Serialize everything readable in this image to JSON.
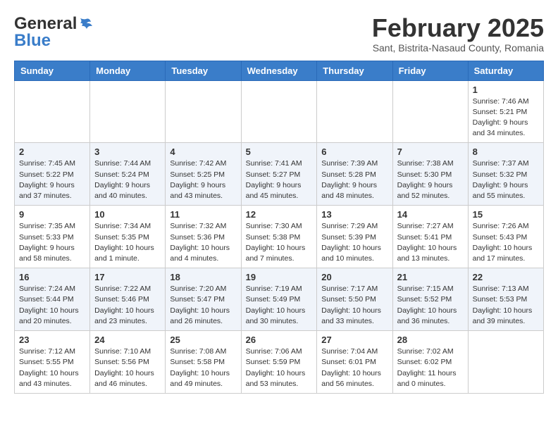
{
  "header": {
    "logo_general": "General",
    "logo_blue": "Blue",
    "month_year": "February 2025",
    "location": "Sant, Bistrita-Nasaud County, Romania"
  },
  "days_of_week": [
    "Sunday",
    "Monday",
    "Tuesday",
    "Wednesday",
    "Thursday",
    "Friday",
    "Saturday"
  ],
  "weeks": [
    [
      {
        "day": "",
        "info": ""
      },
      {
        "day": "",
        "info": ""
      },
      {
        "day": "",
        "info": ""
      },
      {
        "day": "",
        "info": ""
      },
      {
        "day": "",
        "info": ""
      },
      {
        "day": "",
        "info": ""
      },
      {
        "day": "1",
        "info": "Sunrise: 7:46 AM\nSunset: 5:21 PM\nDaylight: 9 hours and 34 minutes."
      }
    ],
    [
      {
        "day": "2",
        "info": "Sunrise: 7:45 AM\nSunset: 5:22 PM\nDaylight: 9 hours and 37 minutes."
      },
      {
        "day": "3",
        "info": "Sunrise: 7:44 AM\nSunset: 5:24 PM\nDaylight: 9 hours and 40 minutes."
      },
      {
        "day": "4",
        "info": "Sunrise: 7:42 AM\nSunset: 5:25 PM\nDaylight: 9 hours and 43 minutes."
      },
      {
        "day": "5",
        "info": "Sunrise: 7:41 AM\nSunset: 5:27 PM\nDaylight: 9 hours and 45 minutes."
      },
      {
        "day": "6",
        "info": "Sunrise: 7:39 AM\nSunset: 5:28 PM\nDaylight: 9 hours and 48 minutes."
      },
      {
        "day": "7",
        "info": "Sunrise: 7:38 AM\nSunset: 5:30 PM\nDaylight: 9 hours and 52 minutes."
      },
      {
        "day": "8",
        "info": "Sunrise: 7:37 AM\nSunset: 5:32 PM\nDaylight: 9 hours and 55 minutes."
      }
    ],
    [
      {
        "day": "9",
        "info": "Sunrise: 7:35 AM\nSunset: 5:33 PM\nDaylight: 9 hours and 58 minutes."
      },
      {
        "day": "10",
        "info": "Sunrise: 7:34 AM\nSunset: 5:35 PM\nDaylight: 10 hours and 1 minute."
      },
      {
        "day": "11",
        "info": "Sunrise: 7:32 AM\nSunset: 5:36 PM\nDaylight: 10 hours and 4 minutes."
      },
      {
        "day": "12",
        "info": "Sunrise: 7:30 AM\nSunset: 5:38 PM\nDaylight: 10 hours and 7 minutes."
      },
      {
        "day": "13",
        "info": "Sunrise: 7:29 AM\nSunset: 5:39 PM\nDaylight: 10 hours and 10 minutes."
      },
      {
        "day": "14",
        "info": "Sunrise: 7:27 AM\nSunset: 5:41 PM\nDaylight: 10 hours and 13 minutes."
      },
      {
        "day": "15",
        "info": "Sunrise: 7:26 AM\nSunset: 5:43 PM\nDaylight: 10 hours and 17 minutes."
      }
    ],
    [
      {
        "day": "16",
        "info": "Sunrise: 7:24 AM\nSunset: 5:44 PM\nDaylight: 10 hours and 20 minutes."
      },
      {
        "day": "17",
        "info": "Sunrise: 7:22 AM\nSunset: 5:46 PM\nDaylight: 10 hours and 23 minutes."
      },
      {
        "day": "18",
        "info": "Sunrise: 7:20 AM\nSunset: 5:47 PM\nDaylight: 10 hours and 26 minutes."
      },
      {
        "day": "19",
        "info": "Sunrise: 7:19 AM\nSunset: 5:49 PM\nDaylight: 10 hours and 30 minutes."
      },
      {
        "day": "20",
        "info": "Sunrise: 7:17 AM\nSunset: 5:50 PM\nDaylight: 10 hours and 33 minutes."
      },
      {
        "day": "21",
        "info": "Sunrise: 7:15 AM\nSunset: 5:52 PM\nDaylight: 10 hours and 36 minutes."
      },
      {
        "day": "22",
        "info": "Sunrise: 7:13 AM\nSunset: 5:53 PM\nDaylight: 10 hours and 39 minutes."
      }
    ],
    [
      {
        "day": "23",
        "info": "Sunrise: 7:12 AM\nSunset: 5:55 PM\nDaylight: 10 hours and 43 minutes."
      },
      {
        "day": "24",
        "info": "Sunrise: 7:10 AM\nSunset: 5:56 PM\nDaylight: 10 hours and 46 minutes."
      },
      {
        "day": "25",
        "info": "Sunrise: 7:08 AM\nSunset: 5:58 PM\nDaylight: 10 hours and 49 minutes."
      },
      {
        "day": "26",
        "info": "Sunrise: 7:06 AM\nSunset: 5:59 PM\nDaylight: 10 hours and 53 minutes."
      },
      {
        "day": "27",
        "info": "Sunrise: 7:04 AM\nSunset: 6:01 PM\nDaylight: 10 hours and 56 minutes."
      },
      {
        "day": "28",
        "info": "Sunrise: 7:02 AM\nSunset: 6:02 PM\nDaylight: 11 hours and 0 minutes."
      },
      {
        "day": "",
        "info": ""
      }
    ]
  ]
}
